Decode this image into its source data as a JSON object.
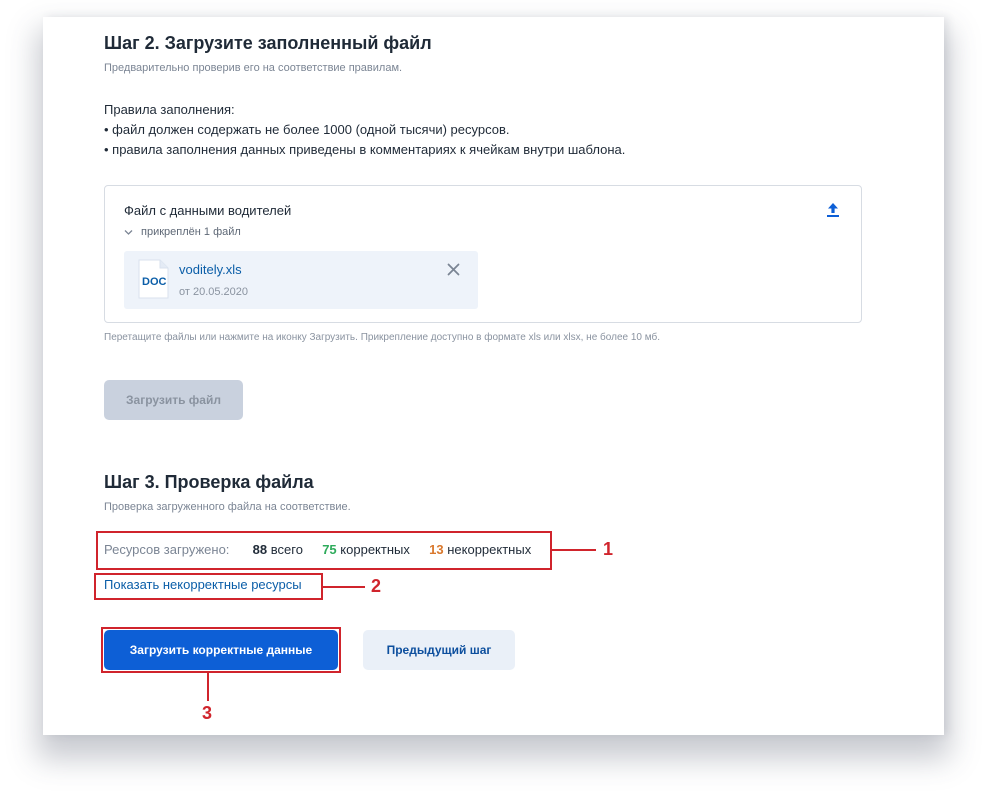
{
  "step2": {
    "title": "Шаг 2. Загрузите заполненный файл",
    "subtitle": "Предварительно проверив его на соответствие правилам.",
    "rules_heading": "Правила заполнения:",
    "rules": [
      "• файл должен содержать не более 1000 (одной тысячи) ресурсов.",
      "• правила заполнения данных приведены в комментариях к ячейкам внутри шаблона."
    ],
    "upload": {
      "label": "Файл с данными водителей",
      "attached_toggle": "прикреплён 1 файл",
      "file": {
        "type_label": "DOC",
        "name": "voditely.xls",
        "date": "от 20.05.2020"
      },
      "hint": "Перетащите файлы или нажмите на иконку Загрузить. Прикрепление доступно в формате xls или xlsx, не более 10 мб."
    },
    "upload_button": "Загрузить файл"
  },
  "step3": {
    "title": "Шаг 3. Проверка файла",
    "subtitle": "Проверка загруженного файла на соответствие.",
    "stats": {
      "label": "Ресурсов загружено:",
      "total_value": "88",
      "total_label": "всего",
      "correct_value": "75",
      "correct_label": "корректных",
      "incorrect_value": "13",
      "incorrect_label": "некорректных"
    },
    "show_incorrect_link": "Показать некорректные ресурсы",
    "primary_button": "Загрузить корректные данные",
    "secondary_button": "Предыдущий шаг"
  },
  "callouts": [
    "1",
    "2",
    "3"
  ],
  "colors": {
    "accent": "#0d5fd6",
    "link": "#0b5ea8",
    "correct": "#2eab5b",
    "incorrect": "#d9782d",
    "annotation": "#d0242c"
  }
}
